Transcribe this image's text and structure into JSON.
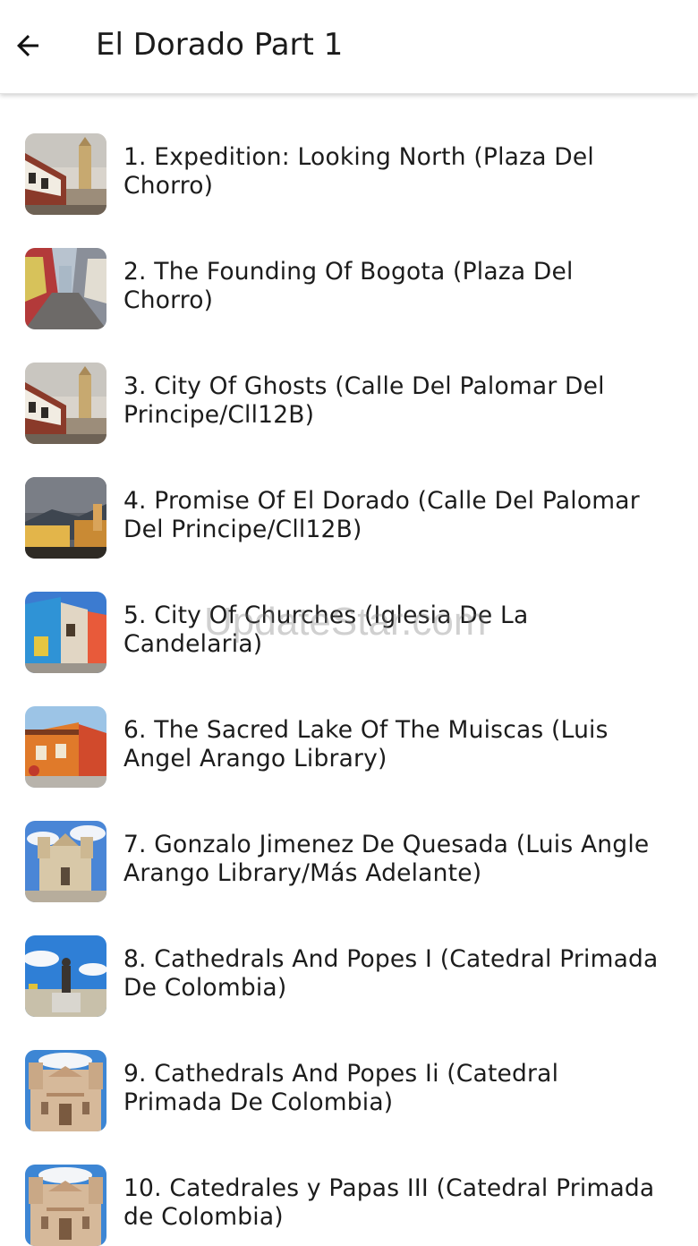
{
  "header": {
    "title": "El Dorado Part 1",
    "back_icon": "arrow-left-icon"
  },
  "items": [
    {
      "label": "1. Expedition: Looking North (Plaza Del Chorro)",
      "thumb": "colonial-street-tower-photo"
    },
    {
      "label": "2. The Founding Of Bogota (Plaza Del Chorro)",
      "thumb": "cobblestone-street-photo"
    },
    {
      "label": "3. City Of Ghosts (Calle Del Palomar Del Principe/Cll12B)",
      "thumb": "colonial-street-tower-photo"
    },
    {
      "label": "4. Promise Of El Dorado (Calle Del Palomar Del Principe/Cll12B)",
      "thumb": "stormy-sky-town-photo"
    },
    {
      "label": "5. City Of Churches (Iglesia De La Candelaria)",
      "thumb": "colorful-houses-photo"
    },
    {
      "label": "6. The Sacred Lake Of The Muiscas (Luis Angel Arango Library)",
      "thumb": "orange-house-photo"
    },
    {
      "label": "7. Gonzalo Jimenez De Quesada (Luis Angle Arango Library/Más Adelante)",
      "thumb": "cathedral-plaza-photo"
    },
    {
      "label": "8. Cathedrals And Popes I (Catedral Primada De Colombia)",
      "thumb": "statue-sky-photo"
    },
    {
      "label": "9. Cathedrals And Popes Ii (Catedral Primada De Colombia)",
      "thumb": "cathedral-facade-photo"
    },
    {
      "label": "10. Catedrales y Papas III (Catedral Primada de Colombia)",
      "thumb": "cathedral-facade-photo"
    }
  ],
  "watermark": "UpdateStar.com"
}
